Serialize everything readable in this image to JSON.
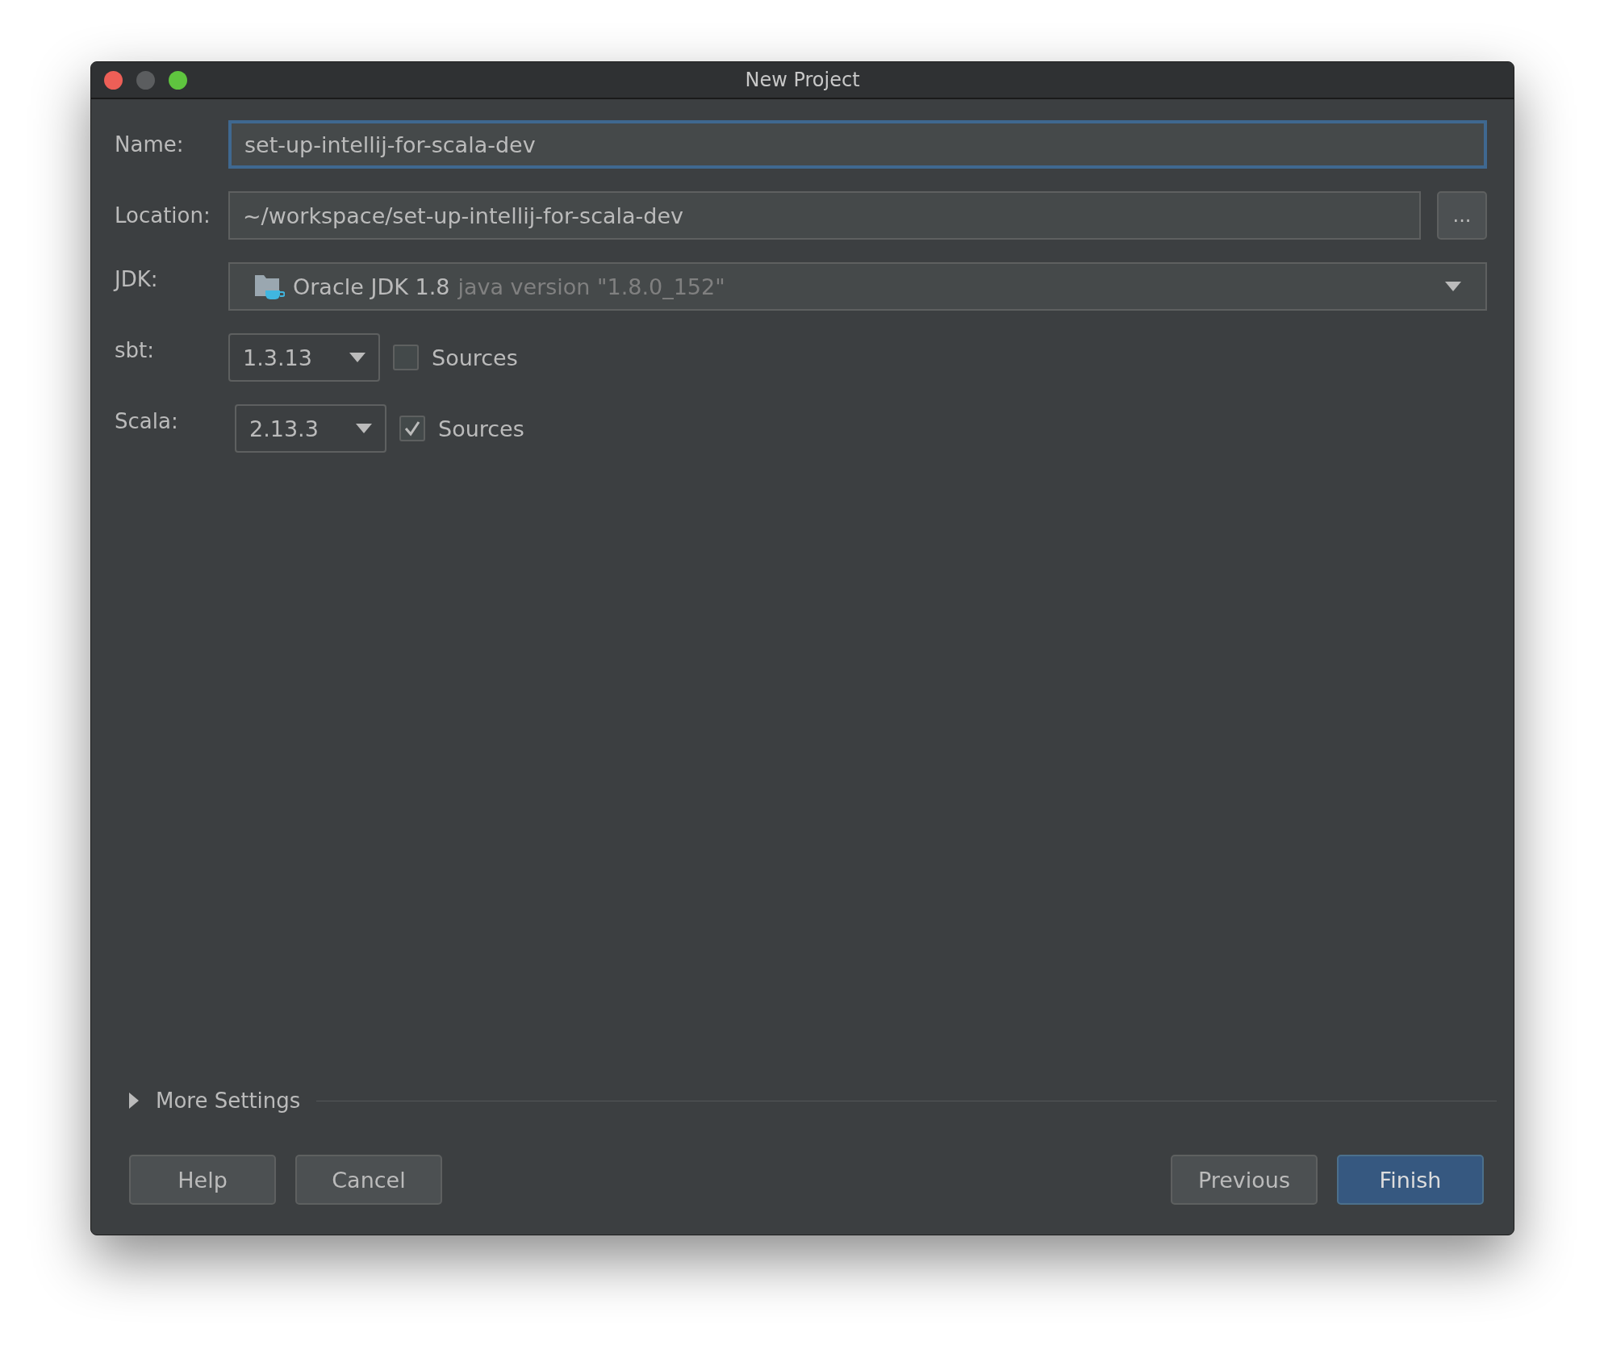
{
  "window": {
    "title": "New Project"
  },
  "name": {
    "label": "Name:",
    "value": "set-up-intellij-for-scala-dev",
    "focused": true
  },
  "location": {
    "label": "Location:",
    "value": "~/workspace/set-up-intellij-for-scala-dev",
    "browse": "..."
  },
  "jdk": {
    "label": "JDK:",
    "name": "Oracle JDK 1.8",
    "version": "java version \"1.8.0_152\""
  },
  "versions": [
    {
      "label": "sbt:",
      "value": "1.3.13",
      "sources_label": "Sources",
      "checked": false
    },
    {
      "label": "Scala:",
      "value": "2.13.3",
      "sources_label": "Sources",
      "checked": true
    }
  ],
  "more_settings": {
    "label": "More Settings",
    "expanded": false
  },
  "buttons_left": [
    {
      "label": "Help",
      "default": false
    },
    {
      "label": "Cancel",
      "default": false
    }
  ],
  "buttons_right": [
    {
      "label": "Previous",
      "default": false
    },
    {
      "label": "Finish",
      "default": true
    }
  ]
}
